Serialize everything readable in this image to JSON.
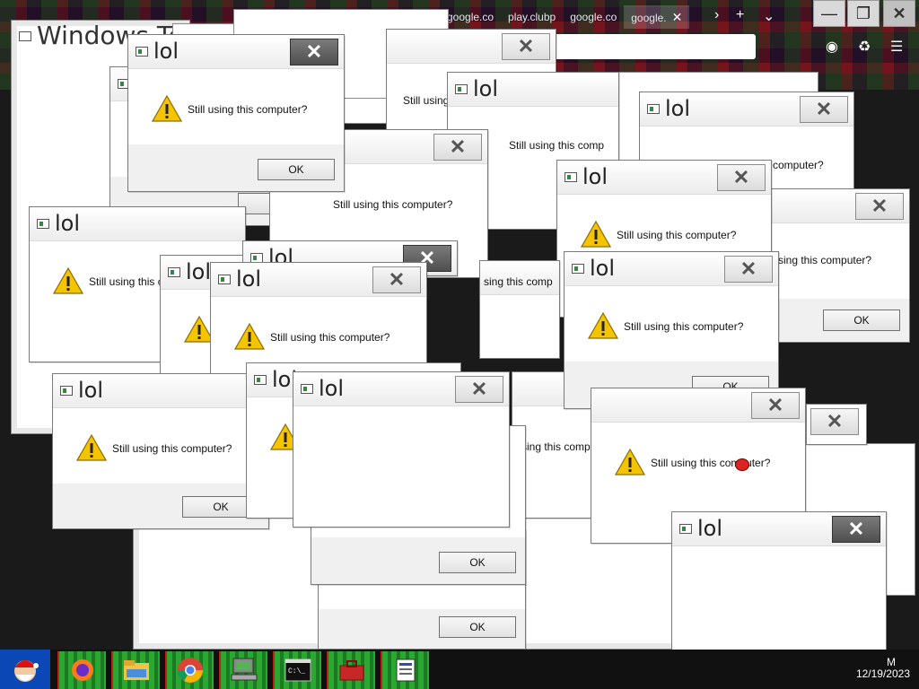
{
  "browser": {
    "tabs": [
      {
        "label": "google.co"
      },
      {
        "label": "play.clubp"
      },
      {
        "label": "google.co"
      },
      {
        "label": "google."
      }
    ],
    "tab_close_glyph": "✕",
    "overflow_glyph": "›",
    "new_tab_glyph": "+",
    "tab_list_glyph": "⌄"
  },
  "window_controls": {
    "minimize": "—",
    "restore": "❐",
    "close": "✕"
  },
  "background_window": {
    "title": "Windows Te"
  },
  "dialog": {
    "title": "lol",
    "message": "Still using this computer?",
    "ok_label": "OK",
    "close_glyph": "✕"
  },
  "partial_texts": {
    "r_question": "r?",
    "still_using": "Still using",
    "still_using_this_comp": "Still using this comp",
    "sing_this_comp": "sing this comp",
    "sing_this_computer": "sing this computer?",
    "computer_q": "computer?"
  },
  "taskbar": {
    "clock_m": "M",
    "date": "12/19/2023",
    "items": [
      {
        "name": "firefox-icon"
      },
      {
        "name": "file-explorer-icon"
      },
      {
        "name": "chrome-icon"
      },
      {
        "name": "computer-icon"
      },
      {
        "name": "command-prompt-icon"
      },
      {
        "name": "toolbox-icon"
      },
      {
        "name": "document-icon"
      }
    ]
  },
  "colors": {
    "taskbar_item": "#2aa832",
    "start": "#0c47b6",
    "warning": "#f5c400",
    "close_active": "#5a5a5a"
  }
}
